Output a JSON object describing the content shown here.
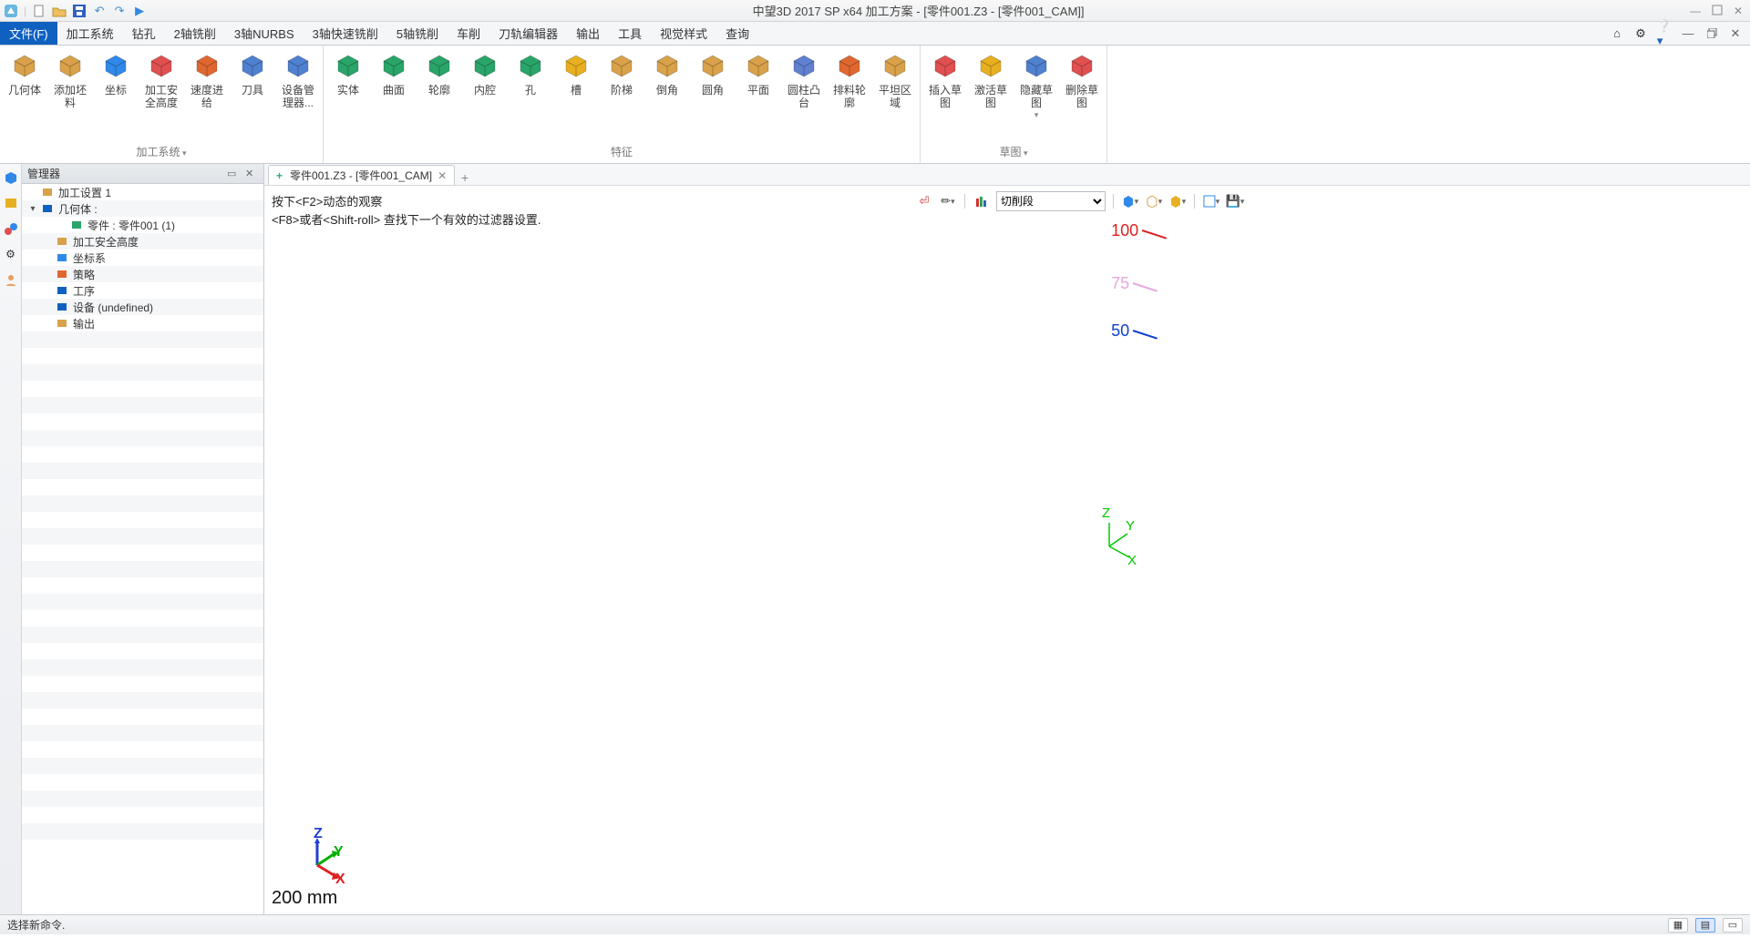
{
  "title": "中望3D 2017 SP x64      加工方案 - [零件001.Z3 - [零件001_CAM]]",
  "qat_icons": [
    "app-icon",
    "new-file-icon",
    "open-file-icon",
    "save-icon",
    "undo-icon",
    "redo-icon",
    "run-icon"
  ],
  "menus": [
    {
      "key": "file",
      "label": "文件(F)",
      "active": true
    },
    {
      "key": "proc",
      "label": "加工系统"
    },
    {
      "key": "drill",
      "label": "钻孔"
    },
    {
      "key": "2axis",
      "label": "2轴铣削"
    },
    {
      "key": "3nurbs",
      "label": "3轴NURBS"
    },
    {
      "key": "3fast",
      "label": "3轴快速铣削"
    },
    {
      "key": "5axis",
      "label": "5轴铣削"
    },
    {
      "key": "turn",
      "label": "车削"
    },
    {
      "key": "toolpath",
      "label": "刀轨编辑器"
    },
    {
      "key": "output",
      "label": "输出"
    },
    {
      "key": "tool",
      "label": "工具"
    },
    {
      "key": "vstyle",
      "label": "视觉样式"
    },
    {
      "key": "query",
      "label": "查询"
    }
  ],
  "menu_right_icons": [
    "home-icon",
    "gear-icon",
    "help-icon"
  ],
  "ribbon_groups": [
    {
      "caption": "加工系统",
      "dd": true,
      "items": [
        {
          "name": "geometry",
          "label": "几何体",
          "color": "#d9a24a"
        },
        {
          "name": "add-blank",
          "label": "添加坯\n料",
          "color": "#d9a24a"
        },
        {
          "name": "coord",
          "label": "坐标",
          "color": "#3089e8"
        },
        {
          "name": "safe-h",
          "label": "加工安\n全高度",
          "color": "#e05050"
        },
        {
          "name": "feed",
          "label": "速度进\n给",
          "color": "#e06830"
        },
        {
          "name": "cutter",
          "label": "刀具",
          "color": "#5080d0"
        },
        {
          "name": "equip",
          "label": "设备管\n理器...",
          "color": "#5080d0"
        }
      ]
    },
    {
      "caption": "特征",
      "dd": false,
      "items": [
        {
          "name": "solid",
          "label": "实体",
          "color": "#2aa56a"
        },
        {
          "name": "surface",
          "label": "曲面",
          "color": "#2aa56a"
        },
        {
          "name": "profile",
          "label": "轮廓",
          "color": "#2aa56a"
        },
        {
          "name": "cavity",
          "label": "内腔",
          "color": "#2aa56a"
        },
        {
          "name": "hole",
          "label": "孔",
          "color": "#2aa56a"
        },
        {
          "name": "slot",
          "label": "槽",
          "color": "#e8b020"
        },
        {
          "name": "step",
          "label": "阶梯",
          "color": "#d9a24a"
        },
        {
          "name": "chamfer",
          "label": "倒角",
          "color": "#d9a24a"
        },
        {
          "name": "fillet",
          "label": "圆角",
          "color": "#d9a24a"
        },
        {
          "name": "plane",
          "label": "平面",
          "color": "#d9a24a"
        },
        {
          "name": "boss",
          "label": "圆柱凸\n台",
          "color": "#6080d0"
        },
        {
          "name": "nest-prof",
          "label": "排料轮\n廓",
          "color": "#e06830"
        },
        {
          "name": "flat",
          "label": "平坦区\n域",
          "color": "#d9a24a"
        }
      ]
    },
    {
      "caption": "草图",
      "dd": true,
      "items": [
        {
          "name": "insert-sk",
          "label": "插入草\n图",
          "color": "#e05050"
        },
        {
          "name": "activate-sk",
          "label": "激活草\n图",
          "color": "#e8b020"
        },
        {
          "name": "hide-sk",
          "label": "隐藏草\n图",
          "color": "#5080d0",
          "dd": true
        },
        {
          "name": "delete-sk",
          "label": "删除草\n图",
          "color": "#e05050"
        }
      ]
    }
  ],
  "manager": {
    "title": "管理器",
    "tree": [
      {
        "level": 0,
        "exp": "",
        "icon": "folder",
        "label": "加工设置 1",
        "color": "#d9a24a"
      },
      {
        "level": 0,
        "exp": "▾",
        "icon": "cube",
        "label": "几何体 :",
        "color": "#1060c0"
      },
      {
        "level": 2,
        "exp": "",
        "icon": "part",
        "label": "零件 : 零件001 (1)",
        "color": "#2aa56a"
      },
      {
        "level": 1,
        "exp": "",
        "icon": "safe",
        "label": "加工安全高度",
        "color": "#d9a24a"
      },
      {
        "level": 1,
        "exp": "",
        "icon": "axis",
        "label": "坐标系",
        "color": "#3089e8"
      },
      {
        "level": 1,
        "exp": "",
        "icon": "strategy",
        "label": "策略",
        "color": "#e06830"
      },
      {
        "level": 1,
        "exp": "",
        "icon": "op",
        "label": "工序",
        "color": "#1060c0"
      },
      {
        "level": 1,
        "exp": "",
        "icon": "device",
        "label": "设备 (undefined)",
        "color": "#1060c0"
      },
      {
        "level": 1,
        "exp": "",
        "icon": "output",
        "label": "输出",
        "color": "#d9a24a"
      }
    ]
  },
  "side_icons": [
    "cube-icon",
    "box-icon",
    "coords-icon",
    "gear-icon",
    "user-icon"
  ],
  "tab": {
    "label": "零件001.Z3 - [零件001_CAM]"
  },
  "hints": {
    "line1": "按下<F2>动态的观察",
    "line2": "<F8>或者<Shift-roll> 查找下一个有效的过滤器设置."
  },
  "view_toolbar": {
    "select_label": "切削段"
  },
  "marks": {
    "m100": "100",
    "m75": "75",
    "m50": "50"
  },
  "axis": {
    "x": "X",
    "y": "Y",
    "z": "Z"
  },
  "scale": "200 mm",
  "status": "选择新命令."
}
